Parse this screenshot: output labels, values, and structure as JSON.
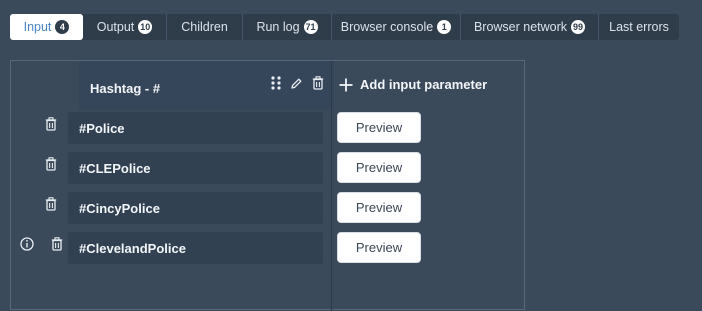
{
  "tabs": [
    {
      "label": "Input",
      "badge": "4",
      "active": true
    },
    {
      "label": "Output",
      "badge": "10"
    },
    {
      "label": "Children",
      "badge": ""
    },
    {
      "label": "Run log",
      "badge": "71"
    },
    {
      "label": "Browser console",
      "badge": "1"
    },
    {
      "label": "Browser network",
      "badge": "99"
    },
    {
      "label": "Last errors",
      "badge": ""
    }
  ],
  "column": {
    "title": "Hashtag - #"
  },
  "add_param_label": "Add input parameter",
  "rows": [
    {
      "value": "#Police",
      "preview": "Preview"
    },
    {
      "value": "#CLEPolice",
      "preview": "Preview"
    },
    {
      "value": "#CincyPolice",
      "preview": "Preview"
    },
    {
      "value": "#ClevelandPolice",
      "preview": "Preview"
    }
  ],
  "icons": {
    "drag": "drag-handle-icon",
    "edit": "pencil-icon",
    "delete": "trash-icon",
    "add": "plus-icon",
    "info": "info-icon"
  }
}
